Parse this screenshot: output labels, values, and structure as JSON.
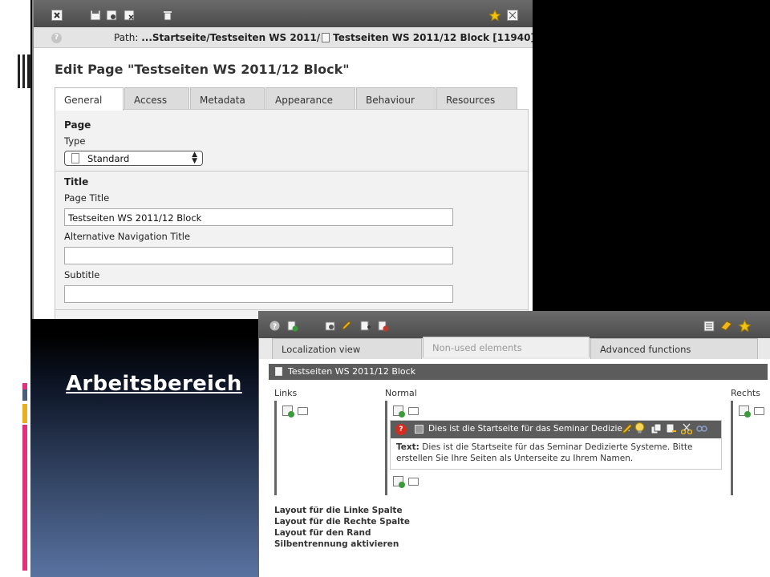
{
  "slide": {
    "title": "Arbeitsbereich",
    "accent_colors": [
      "#e0327a",
      "#4a5d7c",
      "#e8b020",
      "#e0327a"
    ]
  },
  "editor": {
    "path_label": "Path:",
    "path_value": "...Startseite/Testseiten WS 2011/",
    "path_page": "Testseiten WS 2011/12 Block [11940]",
    "heading": "Edit Page \"Testseiten WS 2011/12 Block\"",
    "tabs": [
      {
        "label": "General",
        "active": true
      },
      {
        "label": "Access"
      },
      {
        "label": "Metadata"
      },
      {
        "label": "Appearance"
      },
      {
        "label": "Behaviour"
      },
      {
        "label": "Resources"
      }
    ],
    "page_section": "Page",
    "type_label": "Type",
    "type_value": "Standard",
    "title_section": "Title",
    "page_title_label": "Page Title",
    "page_title_value": "Testseiten WS 2011/12 Block",
    "alt_nav_label": "Alternative Navigation Title",
    "alt_nav_value": "",
    "subtitle_label": "Subtitle",
    "subtitle_value": ""
  },
  "module": {
    "tabs": [
      {
        "label": "Localization view"
      },
      {
        "label": "Non-used elements"
      },
      {
        "label": "Advanced functions"
      }
    ],
    "page_header": "Testseiten WS 2011/12 Block",
    "columns": [
      "Links",
      "Normal",
      "Rechts"
    ],
    "content_element": {
      "header": "Dies ist die Startseite für das Seminar Dedizie...",
      "text_label": "Text:",
      "text": "Dies ist die Startseite für das Seminar Dedizierte Systeme. Bitte erstellen Sie Ihre Seiten als Unterseite zu Ihrem Namen."
    },
    "layout_links": [
      "Layout für die Linke Spalte",
      "Layout für die Rechte Spalte",
      "Layout für den Rand",
      "Silbentrennung aktivieren"
    ]
  }
}
